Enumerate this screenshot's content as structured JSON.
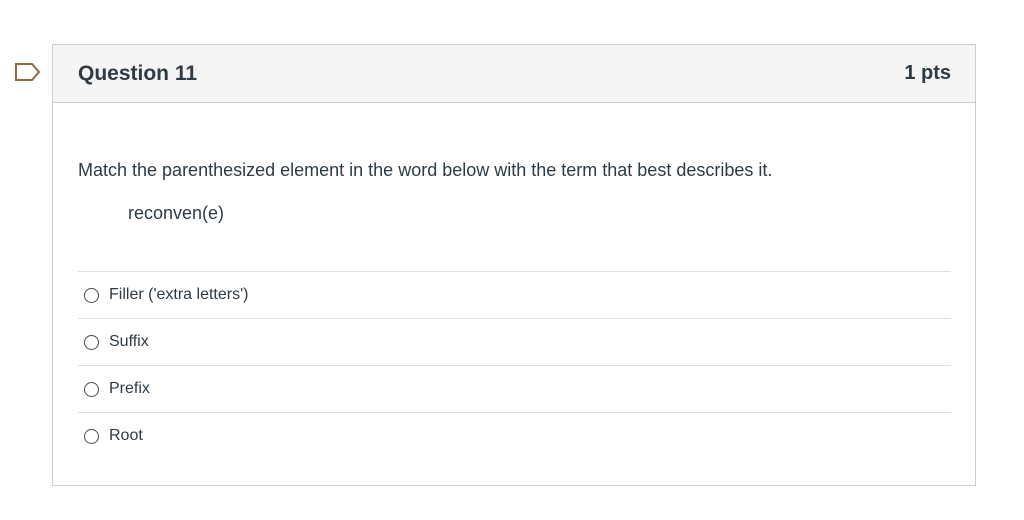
{
  "question": {
    "title": "Question 11",
    "points": "1 pts",
    "prompt": "Match the parenthesized element in the word below with the term that best describes it.",
    "word": "reconven(e)",
    "answers": [
      {
        "label": "Filler ('extra letters')",
        "selected": false
      },
      {
        "label": "Suffix",
        "selected": false
      },
      {
        "label": "Prefix",
        "selected": false
      },
      {
        "label": "Root",
        "selected": false
      }
    ]
  },
  "icons": {
    "flag": "flag-question-icon"
  },
  "colors": {
    "text": "#2d3b45",
    "header_background": "#f5f5f5",
    "border": "#c7cdd1",
    "flag_outline": "#8b6b3a"
  }
}
